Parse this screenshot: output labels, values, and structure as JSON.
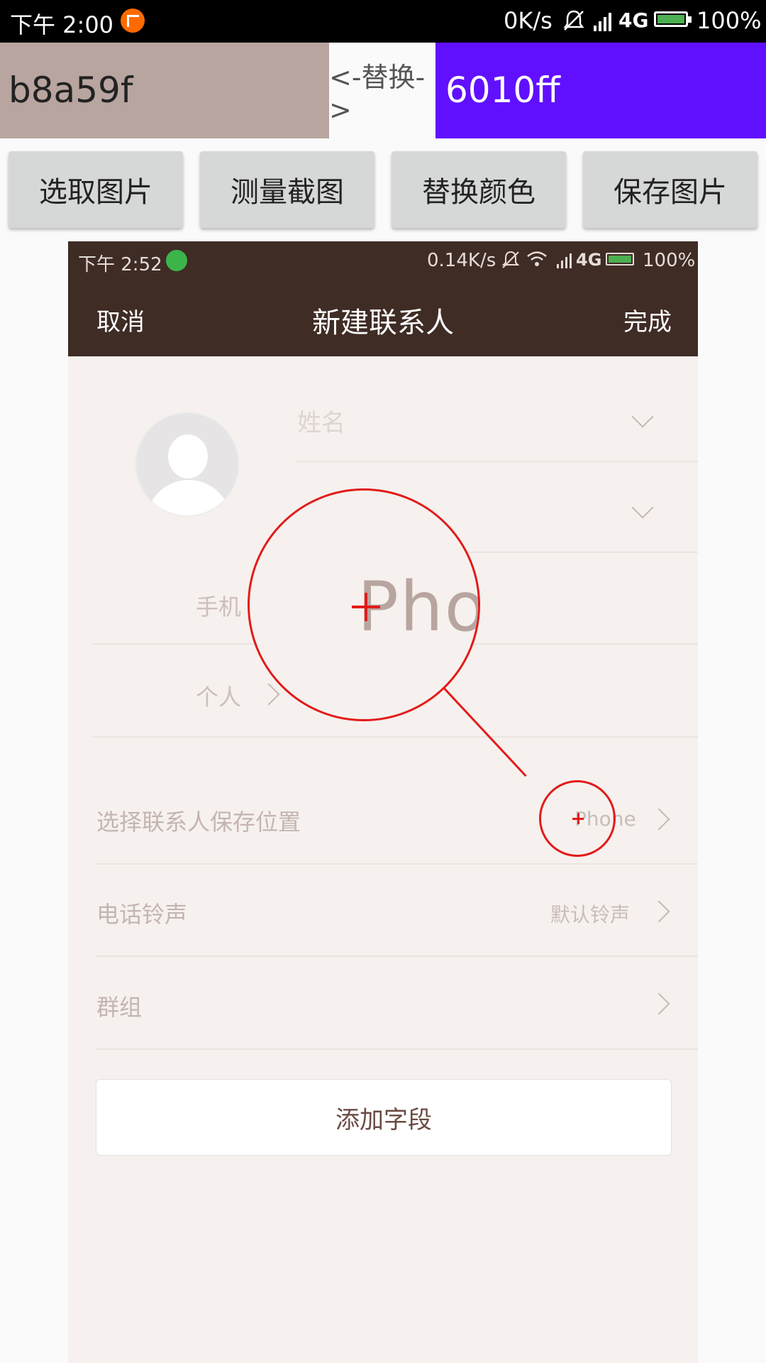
{
  "status_bar": {
    "time": "下午 2:00",
    "net_speed": "0K/s",
    "network": "4G",
    "battery": "100%"
  },
  "colors": {
    "source_hex": "b8a59f",
    "swap_label": "<-替换->",
    "target_hex": "6010ff",
    "source_color": "#b8a59f",
    "target_color": "#6010ff"
  },
  "toolbar": {
    "buttons": [
      "选取图片",
      "测量截图",
      "替换颜色",
      "保存图片"
    ]
  },
  "screenshot": {
    "status_bar": {
      "time": "下午 2:52",
      "net_speed": "0.14K/s",
      "network": "4G",
      "battery": "100%"
    },
    "header": {
      "cancel": "取消",
      "title": "新建联系人",
      "done": "完成"
    },
    "fields": {
      "name_placeholder": "姓名",
      "phone_label": "手机",
      "personal_label": "个人"
    },
    "rows": [
      {
        "label": "选择联系人保存位置",
        "value": "Phone"
      },
      {
        "label": "电话铃声",
        "value": "默认铃声"
      },
      {
        "label": "群组",
        "value": ""
      }
    ],
    "add_field": "添加字段"
  },
  "magnifier": {
    "zoom_text": "Phon"
  }
}
